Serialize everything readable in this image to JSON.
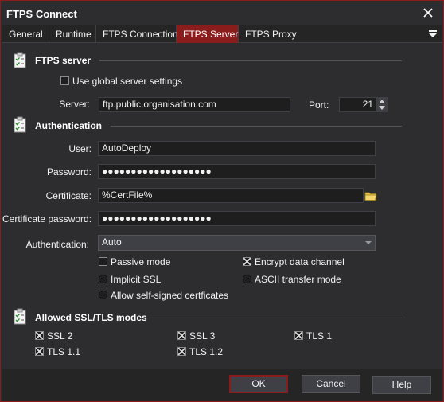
{
  "window": {
    "title": "FTPS Connect"
  },
  "tabs": [
    {
      "label": "General"
    },
    {
      "label": "Runtime"
    },
    {
      "label": "FTPS Connection"
    },
    {
      "label": "FTPS Server"
    },
    {
      "label": "FTPS Proxy"
    }
  ],
  "active_tab": "FTPS Server",
  "ftps_server": {
    "title": "FTPS server",
    "use_global_label": "Use global server settings",
    "use_global_checked": false,
    "server_label": "Server:",
    "server_value": "ftp.public.organisation.com",
    "port_label": "Port:",
    "port_value": "21"
  },
  "authentication": {
    "title": "Authentication",
    "user_label": "User:",
    "user_value": "AutoDeploy",
    "password_label": "Password:",
    "password_value": "●●●●●●●●●●●●●●●●●●●",
    "certificate_label": "Certificate:",
    "certificate_value": "%CertFile%",
    "cert_password_label": "Certificate password:",
    "cert_password_value": "●●●●●●●●●●●●●●●●●●●",
    "auth_label": "Authentication:",
    "auth_value": "Auto",
    "options": {
      "passive_mode": {
        "label": "Passive mode",
        "checked": false
      },
      "encrypt_data": {
        "label": "Encrypt data channel",
        "checked": true
      },
      "implicit_ssl": {
        "label": "Implicit SSL",
        "checked": false
      },
      "ascii_mode": {
        "label": "ASCII transfer mode",
        "checked": false
      },
      "self_signed": {
        "label": "Allow self-signed certficates",
        "checked": false
      }
    }
  },
  "ssl_modes": {
    "title": "Allowed SSL/TLS modes",
    "items": [
      {
        "label": "SSL 2",
        "checked": true
      },
      {
        "label": "SSL 3",
        "checked": true
      },
      {
        "label": "TLS 1",
        "checked": true
      },
      {
        "label": "TLS 1.1",
        "checked": true
      },
      {
        "label": "TLS 1.2",
        "checked": true
      }
    ]
  },
  "buttons": {
    "ok": "OK",
    "cancel": "Cancel",
    "help": "Help"
  },
  "colors": {
    "accent": "#8a1c1c",
    "background": "#2d2d30",
    "input": "#1e1e1e"
  }
}
